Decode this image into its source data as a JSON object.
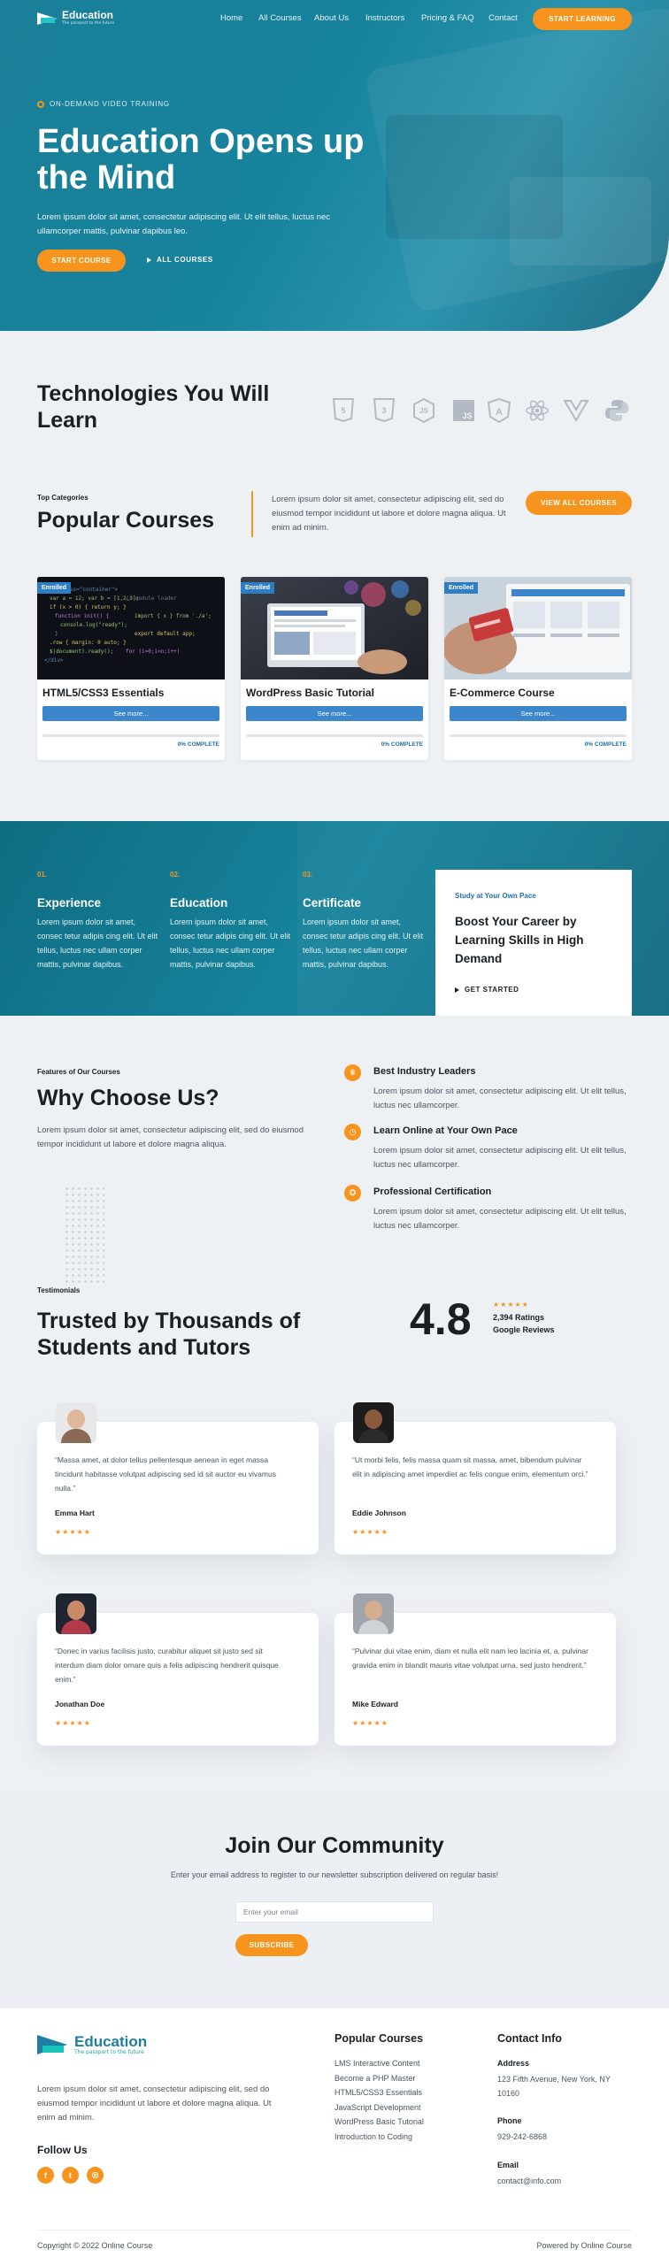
{
  "brand": {
    "name": "Education",
    "tagline": "The passport to the future"
  },
  "colors": {
    "primary": "#17839d",
    "accent": "#f7941d",
    "link_blue": "#3c86cc"
  },
  "nav": {
    "links": [
      "Home",
      "All Courses",
      "About Us",
      "Instructors",
      "Pricing & FAQ",
      "Contact"
    ],
    "cta": "START LEARNING"
  },
  "hero": {
    "kicker": "ON-DEMAND VIDEO TRAINING",
    "title": "Education Opens up the Mind",
    "lead": "Lorem ipsum dolor sit amet, consectetur adipiscing elit. Ut elit tellus, luctus nec ullamcorper mattis, pulvinar dapibus leo.",
    "primary_button": "START COURSE",
    "secondary_link": "ALL COURSES"
  },
  "technologies": {
    "title": "Technologies You Will Learn",
    "icons": [
      "html5-icon",
      "css3-icon",
      "nodejs-icon",
      "javascript-icon",
      "angular-icon",
      "react-icon",
      "vue-icon",
      "python-icon"
    ]
  },
  "popular": {
    "kicker": "Top Categories",
    "title": "Popular Courses",
    "description": "Lorem ipsum dolor sit amet, consectetur adipiscing elit, sed do eiusmod tempor incididunt ut labore et dolore magna aliqua. Ut enim ad minim.",
    "button": "VIEW ALL COURSES",
    "courses": [
      {
        "badge": "Enrolled",
        "title": "HTML5/CSS3 Essentials",
        "button": "See more...",
        "progress": 0,
        "progress_label": "0% COMPLETE"
      },
      {
        "badge": "Enrolled",
        "title": "WordPress Basic Tutorial",
        "button": "See more...",
        "progress": 0,
        "progress_label": "0% COMPLETE"
      },
      {
        "badge": "Enrolled",
        "title": "E-Commerce Course",
        "button": "See more...",
        "progress": 0,
        "progress_label": "0% COMPLETE"
      }
    ]
  },
  "features": [
    {
      "num": "01.",
      "title": "Experience",
      "text": "Lorem ipsum dolor sit amet, consec tetur adipis cing elit. Ut elit tellus, luctus nec ullam corper mattis, pulvinar dapibus."
    },
    {
      "num": "02.",
      "title": "Education",
      "text": "Lorem ipsum dolor sit amet, consec tetur adipis cing elit. Ut elit tellus, luctus nec ullam corper mattis, pulvinar dapibus."
    },
    {
      "num": "03.",
      "title": "Certificate",
      "text": "Lorem ipsum dolor sit amet, consec tetur adipis cing elit. Ut elit tellus, luctus nec ullam corper mattis, pulvinar dapibus."
    }
  ],
  "boost": {
    "kicker": "Study at Your Own Pace",
    "title": "Boost Your Career by Learning Skills in High Demand",
    "link": "GET STARTED"
  },
  "why": {
    "kicker": "Features of Our Courses",
    "title": "Why Choose Us?",
    "description": "Lorem ipsum dolor sit amet, consectetur adipiscing elit, sed do eiusmod tempor incididunt ut labore et dolore magna aliqua.",
    "items": [
      {
        "icon": "crown-icon",
        "title": "Best Industry Leaders",
        "text": "Lorem ipsum dolor sit amet, consectetur adipiscing elit. Ut elit tellus, luctus nec ullamcorper."
      },
      {
        "icon": "clock-icon",
        "title": "Learn Online at Your Own Pace",
        "text": "Lorem ipsum dolor sit amet, consectetur adipiscing elit. Ut elit tellus, luctus nec ullamcorper."
      },
      {
        "icon": "certificate-icon",
        "title": "Professional Certification",
        "text": "Lorem ipsum dolor sit amet, consectetur adipiscing elit. Ut elit tellus, luctus nec ullamcorper."
      }
    ]
  },
  "testimonials": {
    "kicker": "Testimonials",
    "title": "Trusted by Thousands of Students and Tutors",
    "rating": "4.8",
    "stars": "★★★★★",
    "ratings_count": "2,394 Ratings",
    "source": "Google Reviews",
    "items": [
      {
        "quote": "“Massa amet, at dolor tellus pellentesque aenean in eget massa tincidunt habitasse volutpat adipiscing sed id sit auctor eu vivamus nulla.”",
        "name": "Emma Hart",
        "stars": "★★★★★"
      },
      {
        "quote": "“Ut morbi felis, felis massa quam sit massa, amet, bibendum pulvinar elit in adipiscing amet imperdiet ac felis congue enim, elementum orci.”",
        "name": "Eddie Johnson",
        "stars": "★★★★★"
      },
      {
        "quote": "“Donec in varius facilisis justo, curabitur aliquet sit justo sed sit interdum diam dolor ornare quis a felis adipiscing hendrerit quisque enim.”",
        "name": "Jonathan Doe",
        "stars": "★★★★★"
      },
      {
        "quote": "“Pulvinar dui vitae enim, diam et nulla elit nam leo lacinia et, a, pulvinar gravida enim in blandit mauris vitae volutpat urna, sed justo hendrerit.”",
        "name": "Mike Edward",
        "stars": "★★★★★"
      }
    ]
  },
  "join": {
    "title": "Join Our Community",
    "description": "Enter your email address to register to our newsletter subscription delivered on regular basis!",
    "email_placeholder": "Enter your email",
    "button": "SUBSCRIBE"
  },
  "footer": {
    "description": "Lorem ipsum dolor sit amet, consectetur adipiscing elit, sed do eiusmod tempor incididunt ut labore et dolore magna aliqua. Ut enim ad minim.",
    "follow": "Follow Us",
    "social": [
      "facebook-icon",
      "twitter-icon",
      "instagram-icon"
    ],
    "courses_title": "Popular Courses",
    "courses": [
      "LMS Interactive Content",
      "Become a PHP Master",
      "HTML5/CSS3 Essentials",
      "JavaScript Development",
      "WordPress Basic Tutorial",
      "Introduction to Coding"
    ],
    "contact_title": "Contact Info",
    "address_label": "Address",
    "address": "123 Fifth Avenue, New York, NY 10160",
    "phone_label": "Phone",
    "phone": "929-242-6868",
    "email_label": "Email",
    "email": "contact@info.com",
    "copyright": "Copyright © 2022 Online Course",
    "powered": "Powered by Online Course"
  }
}
